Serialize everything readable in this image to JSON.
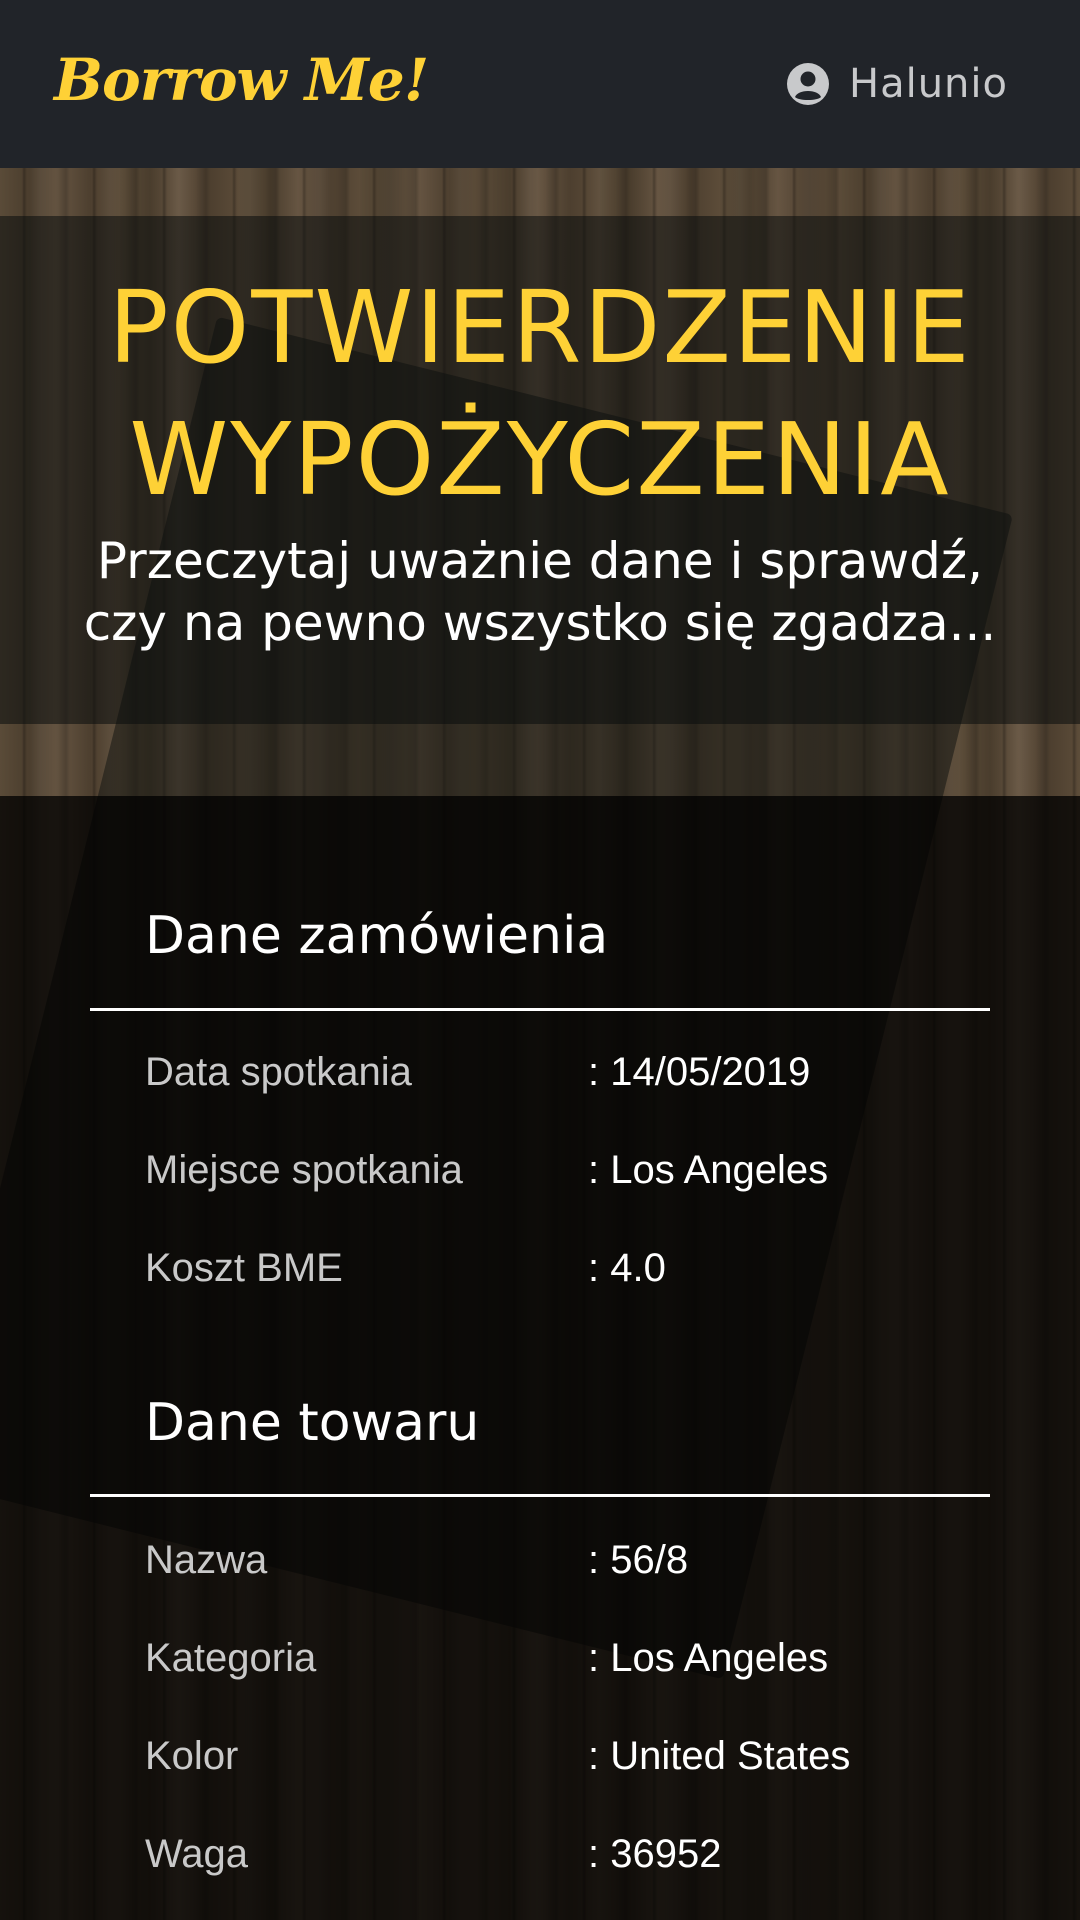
{
  "navbar": {
    "brand": "Borrow Me!",
    "user_icon": "user-circle-icon",
    "user_name": "Halunio"
  },
  "hero": {
    "title_line1": "POTWIERDZENIE",
    "title_line2": "WYPOŻYCZENIA",
    "subtitle_line1": "Przeczytaj uważnie dane i sprawdź,",
    "subtitle_line2": "czy na pewno wszystko się zgadza..."
  },
  "order": {
    "heading": "Dane zamówienia",
    "rows": [
      {
        "label": "Data spotkania",
        "value": ": 14/05/2019"
      },
      {
        "label": "Miejsce spotkania",
        "value": ": Los Angeles"
      },
      {
        "label": "Koszt BME",
        "value": ": 4.0"
      }
    ]
  },
  "item": {
    "heading": "Dane towaru",
    "rows": [
      {
        "label": "Nazwa",
        "value": ": 56/8"
      },
      {
        "label": "Kategoria",
        "value": ": Los Angeles"
      },
      {
        "label": "Kolor",
        "value": ": United States"
      },
      {
        "label": "Waga",
        "value": ": 36952"
      }
    ]
  },
  "colors": {
    "accent": "#fed136",
    "navbar_bg": "#212429",
    "text_light": "#ffffff",
    "text_muted": "#c9c9c9"
  }
}
